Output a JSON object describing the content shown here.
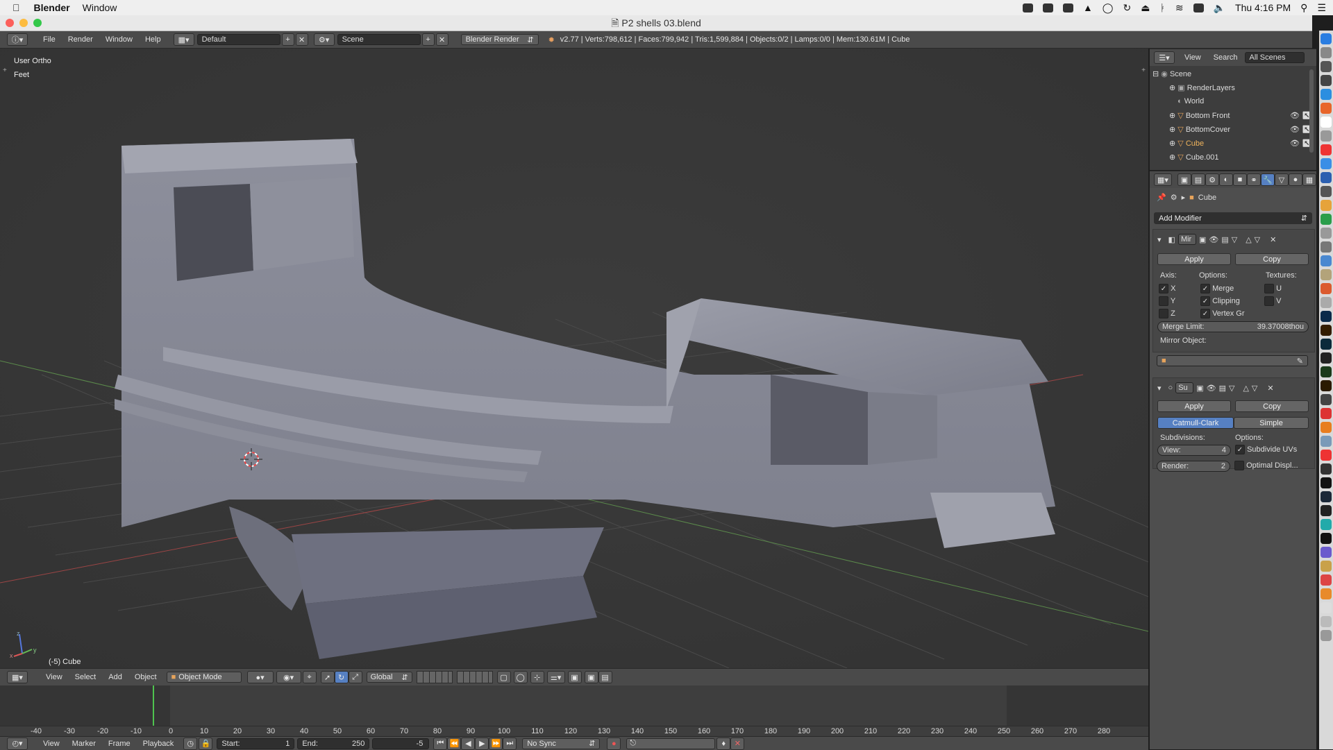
{
  "macbar": {
    "apple": "",
    "app": "Blender",
    "menu": [
      "Window"
    ],
    "clock": "Thu 4:16 PM"
  },
  "window": {
    "title": "P2 shells 03.blend"
  },
  "info_header": {
    "menus": [
      "File",
      "Render",
      "Window",
      "Help"
    ],
    "layout": "Default",
    "scene": "Scene",
    "engine": "Blender Render",
    "stats": "v2.77 | Verts:798,612 | Faces:799,942 | Tris:1,599,884 | Objects:0/2 | Lamps:0/0 | Mem:130.61M | Cube"
  },
  "viewport": {
    "view_name": "User Ortho",
    "units": "Feet",
    "object_label": "(-5) Cube",
    "axis_x": "x",
    "axis_y": "y",
    "axis_z": "z"
  },
  "view3d_header": {
    "menus": [
      "View",
      "Select",
      "Add",
      "Object"
    ],
    "mode": "Object Mode",
    "orientation": "Global"
  },
  "timeline": {
    "ticks": [
      "-40",
      "-30",
      "-20",
      "-10",
      "0",
      "10",
      "20",
      "30",
      "40",
      "50",
      "60",
      "70",
      "80",
      "90",
      "100",
      "110",
      "120",
      "130",
      "140",
      "150",
      "160",
      "170",
      "180",
      "190",
      "200",
      "210",
      "220",
      "230",
      "240",
      "250",
      "260",
      "270",
      "280"
    ],
    "current_frame": 0,
    "menus": [
      "View",
      "Marker",
      "Frame",
      "Playback"
    ],
    "start_label": "Start:",
    "start": "1",
    "end_label": "End:",
    "end": "250",
    "frame": "-5",
    "sync": "No Sync"
  },
  "outliner": {
    "menus": [
      "View",
      "Search"
    ],
    "filter": "All Scenes",
    "items": [
      "Scene",
      "RenderLayers",
      "World",
      "Bottom Front",
      "BottomCover",
      "Cube",
      "Cube.001"
    ]
  },
  "properties": {
    "object": "Cube",
    "add_modifier": "Add Modifier",
    "mirror": {
      "name": "Mir",
      "apply": "Apply",
      "copy": "Copy",
      "axis_label": "Axis:",
      "options_label": "Options:",
      "textures_label": "Textures:",
      "axes": [
        "X",
        "Y",
        "Z"
      ],
      "axes_checked": [
        true,
        false,
        false
      ],
      "options": [
        "Merge",
        "Clipping",
        "Vertex Gr"
      ],
      "options_checked": [
        true,
        true,
        true
      ],
      "textures": [
        "U",
        "V"
      ],
      "textures_checked": [
        false,
        false
      ],
      "merge_limit_label": "Merge Limit:",
      "merge_limit": "39.37008thou",
      "mirror_object_label": "Mirror Object:"
    },
    "subsurf": {
      "name": "Su",
      "apply": "Apply",
      "copy": "Copy",
      "catmull": "Catmull-Clark",
      "simple": "Simple",
      "subdivisions_label": "Subdivisions:",
      "options_label": "Options:",
      "view_label": "View:",
      "view": "4",
      "render_label": "Render:",
      "render": "2",
      "subdivide_uvs": "Subdivide UVs",
      "subdivide_uvs_checked": true,
      "optimal_display": "Optimal Displ...",
      "optimal_display_checked": false
    }
  },
  "colors": {
    "accent": "#5680c2",
    "viewport_bg": "#393939",
    "mesh": "#8a8c99"
  }
}
